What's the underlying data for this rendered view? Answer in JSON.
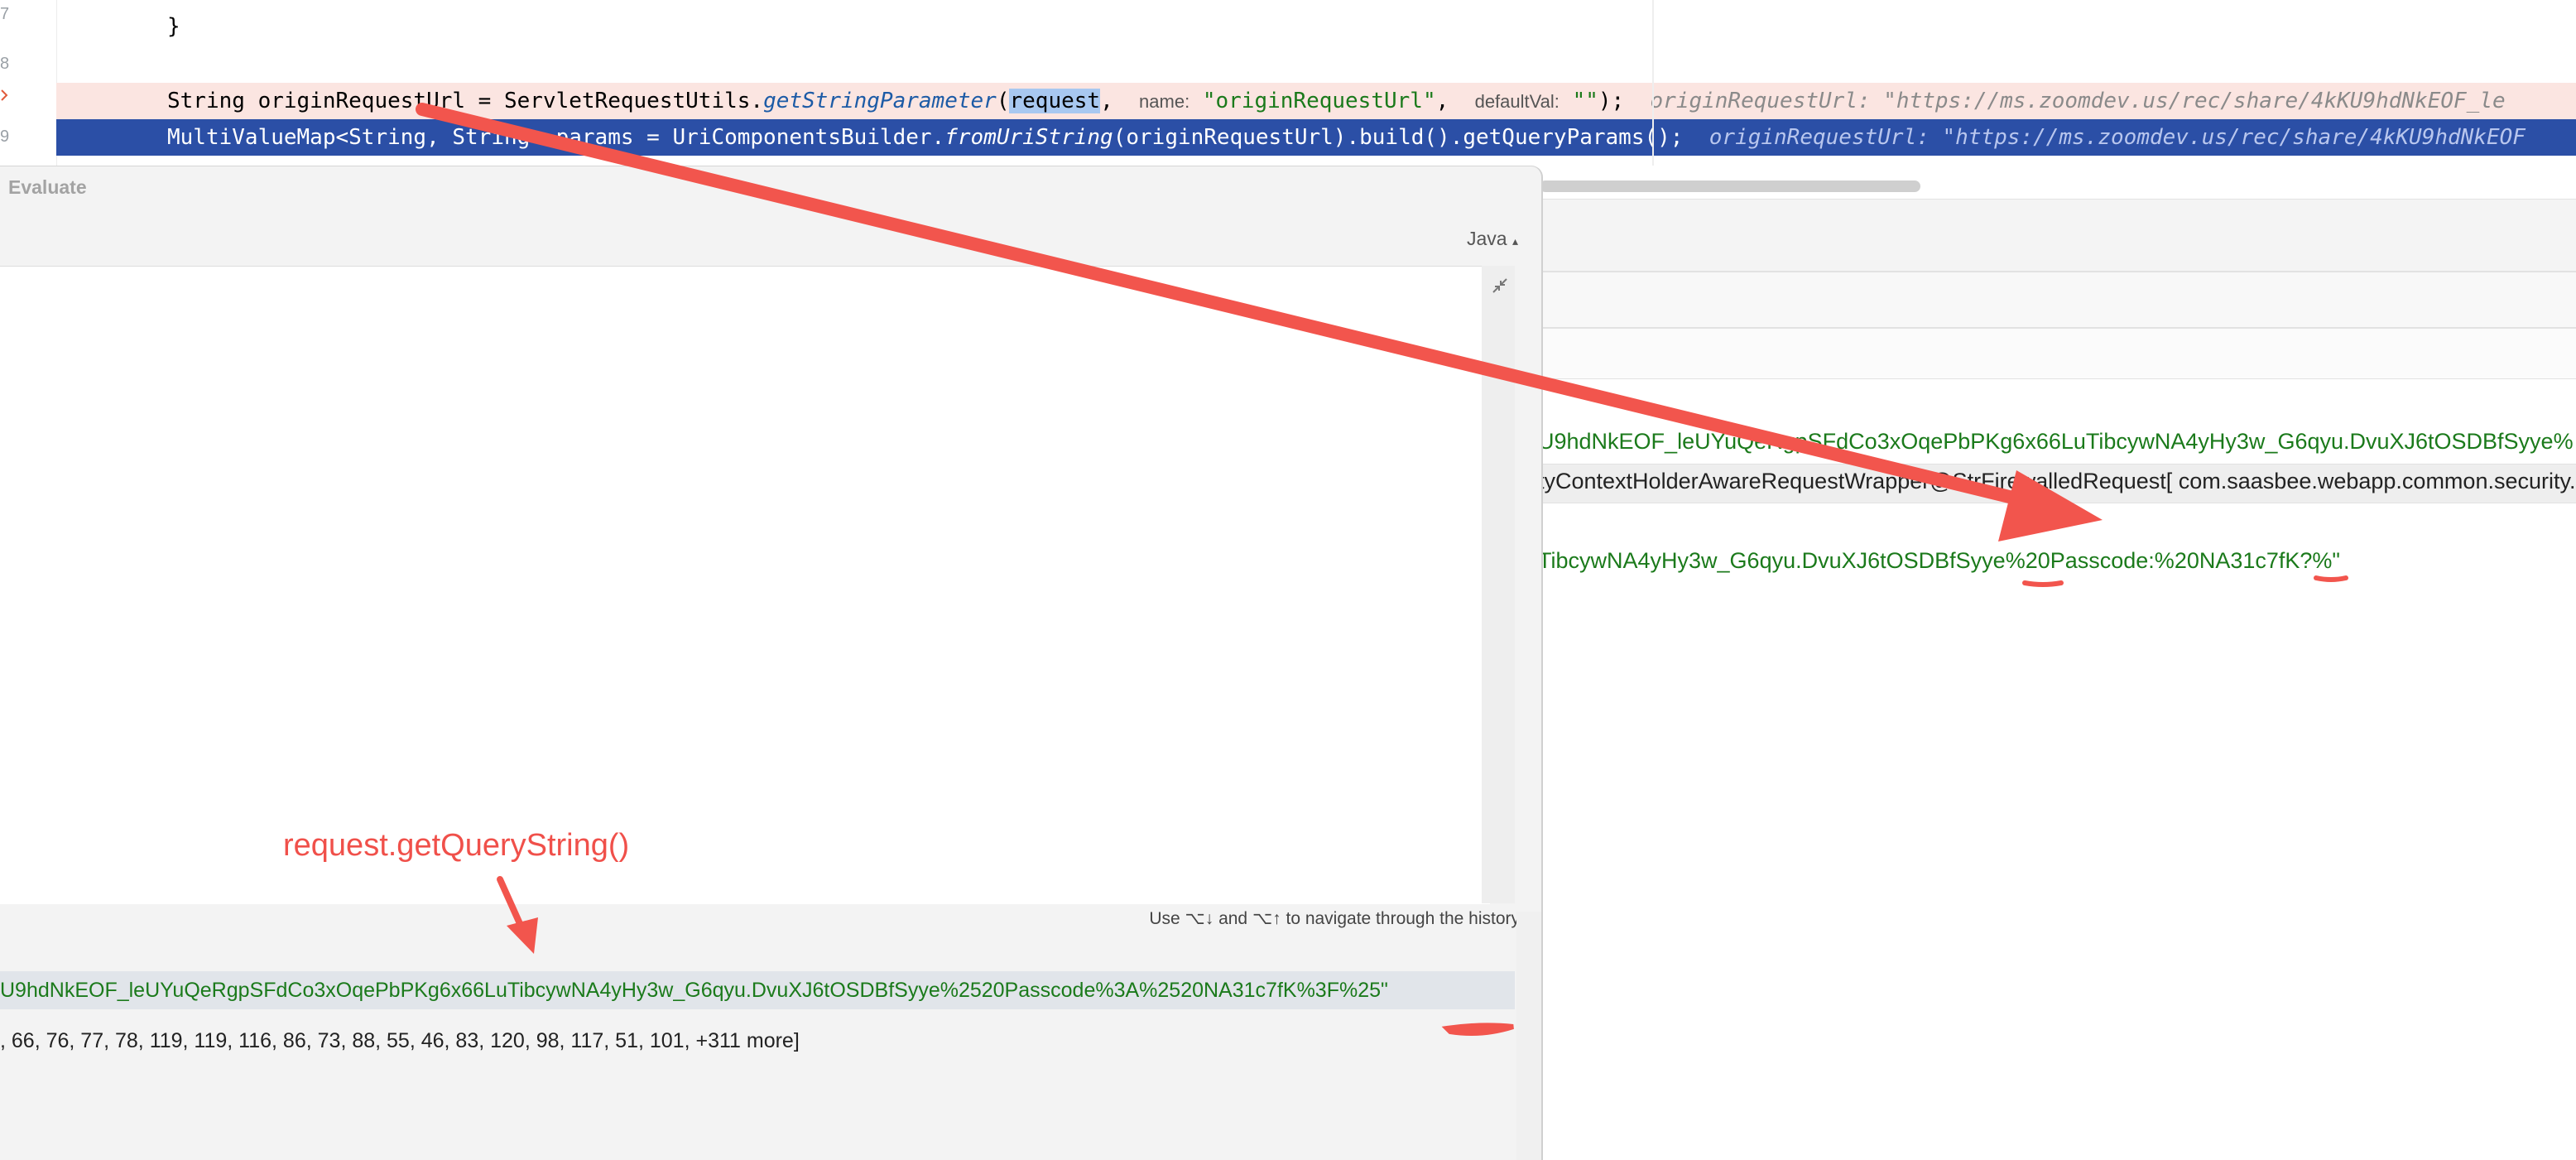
{
  "editor": {
    "line_numbers": [
      "7",
      "8",
      "9"
    ],
    "line1": {
      "brace": "}"
    },
    "line2": {
      "decl": "String originRequestUrl = ServletRequestUtils.",
      "method": "getStringParameter",
      "open": "(",
      "arg_selected": "request",
      "comma": ",",
      "hint_name": "name:",
      "arg_name": "\"originRequestUrl\"",
      "comma2": ",",
      "hint_default": "defaultVal:",
      "arg_default": "\"\"",
      "close": ");",
      "inline_value": "originRequestUrl: \"https://ms.zoomdev.us/rec/share/4kKU9hdNkEOF_le"
    },
    "line3": {
      "decl": "MultiValueMap<String, String> params = UriComponentsBuilder.",
      "method": "fromUriString",
      "rest": "(originRequestUrl).build().getQueryParams();",
      "inline_value": "originRequestUrl: \"https://ms.zoomdev.us/rec/share/4kKU9hdNkEOF"
    }
  },
  "debugger": {
    "var_line1": "U9hdNkEOF_leUYuQeRgpSFdCo3xOqePbPKg6x66LuTibcywNA4yHy3w_G6qyu.DvuXJ6tOSDBfSyye%",
    "var_line2": "tyContextHolderAwareRequestWrapper@StrFirewalledRequest[ com.saasbee.webapp.common.security.h",
    "var_line3": "TibcywNA4yHy3w_G6qyu.DvuXJ6tOSDBfSyye%20Passcode:%20NA31c7fK?%\""
  },
  "evaluate": {
    "title": "Evaluate",
    "language": "Java",
    "language_arrow": "▴",
    "history_hint": "Use ⌥↓ and ⌥↑ to navigate through the history",
    "result_value": "U9hdNkEOF_leUYuQeRgpSFdCo3xOqePbPKg6x66LuTibcywNA4yHy3w_G6qyu.DvuXJ6tOSDBfSyye%2520Passcode%3A%2520NA31c7fK%3F%25\"",
    "array_value": ", 66, 76, 77, 78, 119, 119, 116, 86, 73, 88, 55, 46, 83, 120, 98, 117, 51, 101, +311 more]"
  },
  "annotation": {
    "label": "request.getQueryString()",
    "color": "#f0504a"
  }
}
